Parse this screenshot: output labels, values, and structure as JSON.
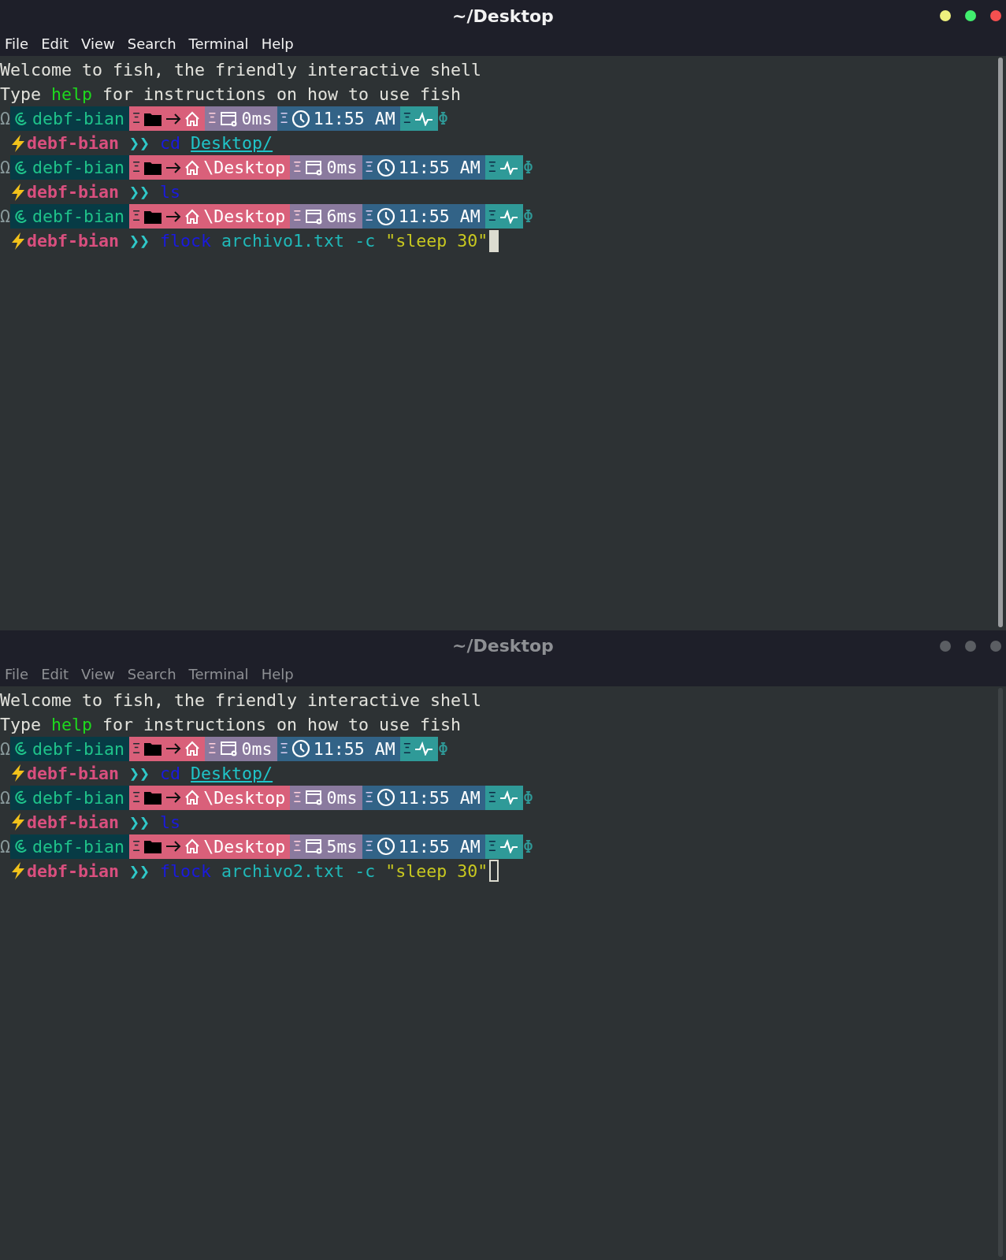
{
  "windows": [
    {
      "title": "~/Desktop",
      "active": true,
      "menu": [
        "File",
        "Edit",
        "View",
        "Search",
        "Terminal",
        "Help"
      ],
      "lines": [
        {
          "kind": "plain",
          "text": "Welcome to fish, the friendly interactive shell"
        },
        {
          "kind": "help",
          "before": "Type",
          "keyword": "help",
          "after": "for instructions on how to use fish"
        },
        {
          "kind": "status",
          "lead": "Ω",
          "host": "debf-bian",
          "separators": [
            "Ξ",
            "Ξ",
            "Ξ",
            "Ξ"
          ],
          "duration": "0ms",
          "time": "11:55 AM",
          "tail": "Φ"
        },
        {
          "kind": "command",
          "user": "debf-bian",
          "arrow": "❯❯",
          "command": "cd",
          "args": [
            {
              "text": "Desktop/",
              "kind": "path"
            }
          ],
          "cursor": false
        },
        {
          "kind": "status",
          "lead": "Ω",
          "host": "debf-bian",
          "separators": [
            "Ξ",
            "Ξ",
            "Ξ",
            "Ξ"
          ],
          "path": "\\Desktop",
          "duration": "0ms",
          "time": "11:55 AM",
          "tail": "Φ"
        },
        {
          "kind": "command",
          "user": "debf-bian",
          "arrow": "❯❯",
          "command": "ls",
          "cursor": false
        },
        {
          "kind": "status",
          "lead": "Ω",
          "host": "debf-bian",
          "separators": [
            "Ξ",
            "Ξ",
            "Ξ",
            "Ξ"
          ],
          "path": "\\Desktop",
          "duration": "6ms",
          "time": "11:55 AM",
          "tail": "Φ"
        },
        {
          "kind": "command",
          "user": "debf-bian",
          "arrow": "❯❯",
          "command": "flock",
          "args": [
            {
              "text": "archivo1.txt",
              "kind": "word"
            },
            {
              "text": "-c",
              "kind": "word"
            },
            {
              "text": "\"sleep 30\"",
              "kind": "string"
            }
          ],
          "cursor": true
        }
      ]
    },
    {
      "title": "~/Desktop",
      "active": false,
      "menu": [
        "File",
        "Edit",
        "View",
        "Search",
        "Terminal",
        "Help"
      ],
      "lines": [
        {
          "kind": "plain",
          "text": "Welcome to fish, the friendly interactive shell"
        },
        {
          "kind": "help",
          "before": "Type",
          "keyword": "help",
          "after": "for instructions on how to use fish"
        },
        {
          "kind": "status",
          "lead": "Ω",
          "host": "debf-bian",
          "separators": [
            "Ξ",
            "Ξ",
            "Ξ",
            "Ξ"
          ],
          "duration": "0ms",
          "time": "11:55 AM",
          "tail": "Φ"
        },
        {
          "kind": "command",
          "user": "debf-bian",
          "arrow": "❯❯",
          "command": "cd",
          "args": [
            {
              "text": "Desktop/",
              "kind": "path"
            }
          ],
          "cursor": false
        },
        {
          "kind": "status",
          "lead": "Ω",
          "host": "debf-bian",
          "separators": [
            "Ξ",
            "Ξ",
            "Ξ",
            "Ξ"
          ],
          "path": "\\Desktop",
          "duration": "0ms",
          "time": "11:55 AM",
          "tail": "Φ"
        },
        {
          "kind": "command",
          "user": "debf-bian",
          "arrow": "❯❯",
          "command": "ls",
          "cursor": false
        },
        {
          "kind": "status",
          "lead": "Ω",
          "host": "debf-bian",
          "separators": [
            "Ξ",
            "Ξ",
            "Ξ",
            "Ξ"
          ],
          "path": "\\Desktop",
          "duration": "5ms",
          "time": "11:55 AM",
          "tail": "Φ"
        },
        {
          "kind": "command",
          "user": "debf-bian",
          "arrow": "❯❯",
          "command": "flock",
          "args": [
            {
              "text": "archivo2.txt",
              "kind": "word"
            },
            {
              "text": "-c",
              "kind": "word"
            },
            {
              "text": "\"sleep 30\"",
              "kind": "string"
            }
          ],
          "cursor": true
        }
      ]
    }
  ]
}
